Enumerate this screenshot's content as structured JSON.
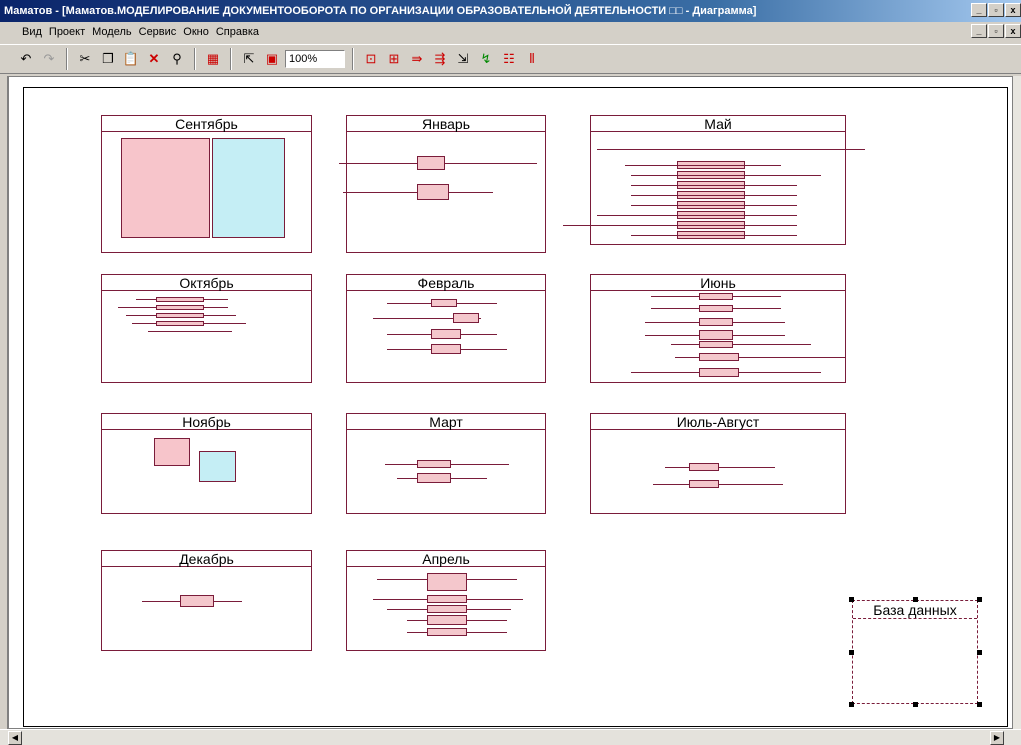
{
  "window": {
    "title": "Маматов - [Маматов.МОДЕЛИРОВАНИЕ ДОКУМЕНТООБОРОТА ПО ОРГАНИЗАЦИИ ОБРАЗОВАТЕЛЬНОЙ ДЕЯТЕЛЬНОСТИ □□ - Диаграмма]"
  },
  "menu": [
    "Вид",
    "Проект",
    "Модель",
    "Сервис",
    "Окно",
    "Справка"
  ],
  "toolbar": {
    "zoom": "100%",
    "icons": [
      "undo-icon",
      "redo-icon",
      "cut-icon",
      "copy-icon",
      "paste-icon",
      "delete-icon",
      "find-icon",
      "export-icon",
      "pointer-icon",
      "frame-icon",
      "page-icon",
      "page-add-icon",
      "flow-right-icon",
      "flow-both-icon",
      "select-icon",
      "link-icon",
      "align-icon",
      "split-icon"
    ]
  },
  "panels": [
    {
      "title": "Сентябрь"
    },
    {
      "title": "Январь"
    },
    {
      "title": "Май"
    },
    {
      "title": "Октябрь"
    },
    {
      "title": "Февраль"
    },
    {
      "title": "Июнь"
    },
    {
      "title": "Ноябрь"
    },
    {
      "title": "Март"
    },
    {
      "title": "Июль-Август"
    },
    {
      "title": "Декабрь"
    },
    {
      "title": "Апрель"
    }
  ],
  "database": {
    "title": "База данных"
  },
  "colors": {
    "border": "#7a1c3a",
    "pink": "#f7c5cb",
    "blue": "#c5eef5"
  }
}
